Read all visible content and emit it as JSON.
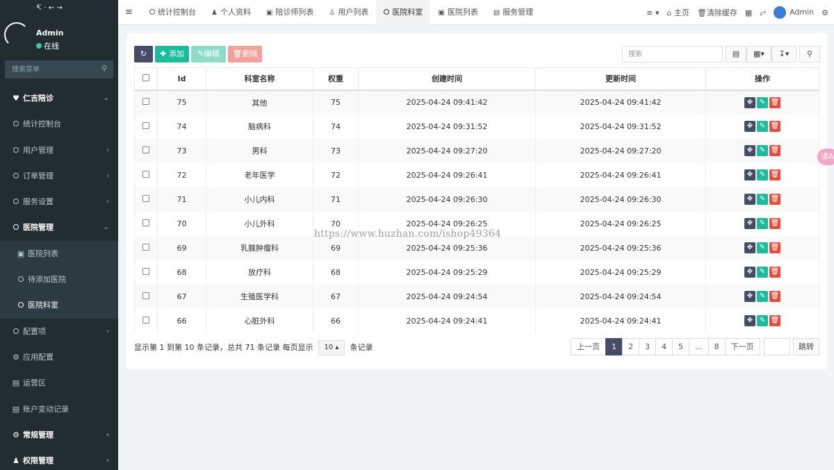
{
  "sidebar": {
    "logo_text": "↸ · ← →",
    "user": {
      "name": "Admin",
      "status": "在线"
    },
    "search_placeholder": "搜索菜单",
    "menu": [
      {
        "label": "仁吉陪诊",
        "icon": "heartbeat-icon",
        "type": "top",
        "arrow": "chevron-down"
      },
      {
        "label": "统计控制台",
        "icon": "circle-icon",
        "type": "item"
      },
      {
        "label": "用户管理",
        "icon": "circle-icon",
        "type": "item",
        "arrow": "chevron-left"
      },
      {
        "label": "订单管理",
        "icon": "circle-icon",
        "type": "item",
        "arrow": "chevron-left"
      },
      {
        "label": "服务设置",
        "icon": "circle-icon",
        "type": "item",
        "arrow": "chevron-left"
      },
      {
        "label": "医院管理",
        "icon": "circle-icon",
        "type": "open",
        "arrow": "chevron-down"
      },
      {
        "label": "医院列表",
        "icon": "hospital-icon",
        "type": "sub"
      },
      {
        "label": "待添加医院",
        "icon": "circle-icon",
        "type": "sub"
      },
      {
        "label": "医院科室",
        "icon": "circle-icon",
        "type": "sub-active"
      },
      {
        "label": "配置项",
        "icon": "circle-icon",
        "type": "item",
        "arrow": "chevron-left"
      },
      {
        "label": "应用配置",
        "icon": "gear-icon",
        "type": "item"
      },
      {
        "label": "运营区",
        "icon": "map-icon",
        "type": "item"
      },
      {
        "label": "账户变动记录",
        "icon": "list-icon",
        "type": "item"
      },
      {
        "label": "常规管理",
        "icon": "cogs-icon",
        "type": "top",
        "arrow": "chevron-left"
      },
      {
        "label": "权限管理",
        "icon": "users-icon",
        "type": "top",
        "arrow": "chevron-left"
      }
    ]
  },
  "topbar": {
    "tabs": [
      {
        "label": "统计控制台",
        "icon": "circle-icon"
      },
      {
        "label": "个人资料",
        "icon": "user-icon"
      },
      {
        "label": "陪诊师列表",
        "icon": "id-card-icon"
      },
      {
        "label": "用户列表",
        "icon": "user-outline-icon"
      },
      {
        "label": "医院科室",
        "icon": "circle-icon",
        "active": true
      },
      {
        "label": "医院列表",
        "icon": "hospital-icon"
      },
      {
        "label": "服务管理",
        "icon": "list-icon"
      }
    ],
    "home_label": "主页",
    "clear_cache_label": "清除缓存",
    "admin_label": "Admin"
  },
  "toolbar": {
    "add_label": "添加",
    "edit_label": "编辑",
    "delete_label": "删除",
    "search_placeholder": "搜索"
  },
  "table": {
    "columns": [
      "Id",
      "科室名称",
      "权重",
      "创建时间",
      "更新时间",
      "操作"
    ],
    "rows": [
      {
        "id": "75",
        "name": "其他",
        "weight": "75",
        "created": "2025-04-24 09:41:42",
        "updated": "2025-04-24 09:41:42"
      },
      {
        "id": "74",
        "name": "脑病科",
        "weight": "74",
        "created": "2025-04-24 09:31:52",
        "updated": "2025-04-24 09:31:52"
      },
      {
        "id": "73",
        "name": "男科",
        "weight": "73",
        "created": "2025-04-24 09:27:20",
        "updated": "2025-04-24 09:27:20"
      },
      {
        "id": "72",
        "name": "老年医学",
        "weight": "72",
        "created": "2025-04-24 09:26:41",
        "updated": "2025-04-24 09:26:41"
      },
      {
        "id": "71",
        "name": "小儿内科",
        "weight": "71",
        "created": "2025-04-24 09:26:30",
        "updated": "2025-04-24 09:26:30"
      },
      {
        "id": "70",
        "name": "小儿外科",
        "weight": "70",
        "created": "2025-04-24 09:26:25",
        "updated": "2025-04-24 09:26:25"
      },
      {
        "id": "69",
        "name": "乳腺肿瘤科",
        "weight": "69",
        "created": "2025-04-24 09:25:36",
        "updated": "2025-04-24 09:25:36"
      },
      {
        "id": "68",
        "name": "放疗科",
        "weight": "68",
        "created": "2025-04-24 09:25:29",
        "updated": "2025-04-24 09:25:29"
      },
      {
        "id": "67",
        "name": "生殖医学科",
        "weight": "67",
        "created": "2025-04-24 09:24:54",
        "updated": "2025-04-24 09:24:54"
      },
      {
        "id": "66",
        "name": "心脏外科",
        "weight": "66",
        "created": "2025-04-24 09:24:41",
        "updated": "2025-04-24 09:24:41"
      }
    ]
  },
  "pagination": {
    "summary_before": "显示第 1 到第 10 条记录，总共 71 条记录 每页显示",
    "page_size": "10",
    "summary_after": "条记录",
    "prev_label": "上一页",
    "pages": [
      "1",
      "2",
      "3",
      "4",
      "5",
      "...",
      "8"
    ],
    "current_page": "1",
    "next_label": "下一页",
    "jump_label": "跳转"
  },
  "watermark": "https://www.huzhan.com/ishop49364",
  "float_badge": "译A"
}
